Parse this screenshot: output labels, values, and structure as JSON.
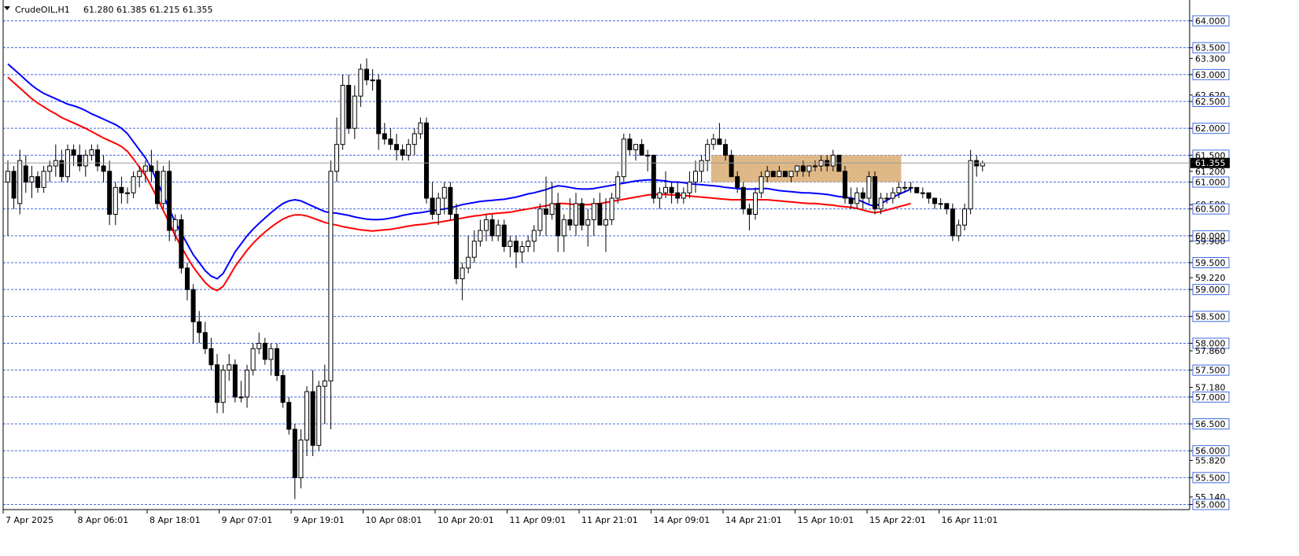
{
  "header": {
    "symbol": "CrudeOIL,H1",
    "ohlc": "61.280 61.385 61.215 61.355"
  },
  "chart_data": {
    "type": "candlestick",
    "symbol": "CrudeOIL",
    "timeframe": "H1",
    "ylim": [
      55.0,
      64.4
    ],
    "grid": true,
    "grid_levels": [
      64.0,
      63.5,
      63.0,
      62.5,
      62.0,
      61.5,
      61.0,
      60.5,
      60.0,
      59.5,
      59.0,
      58.5,
      58.0,
      57.5,
      57.0,
      56.5,
      56.0,
      55.5,
      55.0
    ],
    "price_labels": [
      {
        "value": 64.0,
        "text": "64.000",
        "boxed": true
      },
      {
        "value": 63.5,
        "text": "63.500",
        "boxed": true
      },
      {
        "value": 63.3,
        "text": "63.300",
        "boxed": false
      },
      {
        "value": 63.0,
        "text": "63.000",
        "boxed": true
      },
      {
        "value": 62.62,
        "text": "62.620",
        "boxed": false
      },
      {
        "value": 62.5,
        "text": "62.500",
        "boxed": true
      },
      {
        "value": 62.0,
        "text": "62.000",
        "boxed": true
      },
      {
        "value": 61.5,
        "text": "61.500",
        "boxed": true
      },
      {
        "value": 61.2,
        "text": "61.200",
        "boxed": false
      },
      {
        "value": 61.0,
        "text": "61.000",
        "boxed": true
      },
      {
        "value": 60.58,
        "text": "60.580",
        "boxed": false
      },
      {
        "value": 60.5,
        "text": "60.500",
        "boxed": true
      },
      {
        "value": 60.0,
        "text": "60.000",
        "boxed": true
      },
      {
        "value": 59.9,
        "text": "59.900",
        "boxed": false
      },
      {
        "value": 59.5,
        "text": "59.500",
        "boxed": true
      },
      {
        "value": 59.22,
        "text": "59.220",
        "boxed": false
      },
      {
        "value": 59.0,
        "text": "59.000",
        "boxed": true
      },
      {
        "value": 58.5,
        "text": "58.500",
        "boxed": true
      },
      {
        "value": 58.0,
        "text": "58.000",
        "boxed": true
      },
      {
        "value": 57.86,
        "text": "57.860",
        "boxed": false
      },
      {
        "value": 57.5,
        "text": "57.500",
        "boxed": true
      },
      {
        "value": 57.18,
        "text": "57.180",
        "boxed": false
      },
      {
        "value": 57.0,
        "text": "57.000",
        "boxed": true
      },
      {
        "value": 56.5,
        "text": "56.500",
        "boxed": true
      },
      {
        "value": 56.0,
        "text": "56.000",
        "boxed": true
      },
      {
        "value": 55.82,
        "text": "55.820",
        "boxed": false
      },
      {
        "value": 55.5,
        "text": "55.500",
        "boxed": true
      },
      {
        "value": 55.14,
        "text": "55.140",
        "boxed": false
      },
      {
        "value": 55.0,
        "text": "55.000",
        "boxed": true
      }
    ],
    "current_price": {
      "value": 61.355,
      "text": "61.355"
    },
    "time_labels": [
      "7 Apr 2025",
      "8 Apr 06:01",
      "8 Apr 18:01",
      "9 Apr 07:01",
      "9 Apr 19:01",
      "10 Apr 08:01",
      "10 Apr 20:01",
      "11 Apr 09:01",
      "11 Apr 21:01",
      "14 Apr 09:01",
      "14 Apr 21:01",
      "15 Apr 10:01",
      "15 Apr 22:01",
      "16 Apr 11:01"
    ],
    "resistance_zone": {
      "from_bar": 118,
      "to_bar": 149,
      "low": 61.0,
      "high": 61.5,
      "color": "#deb887"
    },
    "colors": {
      "grid": "#4169e1",
      "bull_body": "#ffffff",
      "bear_body": "#000000",
      "candle_outline": "#000000",
      "ma_fast": "#0000ff",
      "ma_slow": "#ff0000",
      "current_price_bg": "#000000"
    },
    "ma_fast": [
      63.2,
      63.1,
      63.0,
      62.9,
      62.8,
      62.72,
      62.65,
      62.6,
      62.55,
      62.5,
      62.45,
      62.42,
      62.38,
      62.33,
      62.27,
      62.22,
      62.17,
      62.12,
      62.07,
      62.0,
      61.9,
      61.75,
      61.6,
      61.45,
      61.25,
      61.0,
      60.75,
      60.5,
      60.25,
      60.05,
      59.85,
      59.65,
      59.5,
      59.35,
      59.25,
      59.2,
      59.3,
      59.5,
      59.7,
      59.85,
      60.0,
      60.12,
      60.23,
      60.33,
      60.43,
      60.52,
      60.6,
      60.65,
      60.67,
      60.65,
      60.6,
      60.55,
      60.5,
      60.45,
      60.43,
      60.42,
      60.4,
      60.38,
      60.35,
      60.33,
      60.31,
      60.3,
      60.3,
      60.31,
      60.33,
      60.35,
      60.38,
      60.4,
      60.42,
      60.43,
      60.45,
      60.47,
      60.48,
      60.5,
      60.52,
      60.55,
      60.58,
      60.6,
      60.62,
      60.64,
      60.65,
      60.66,
      60.67,
      60.68,
      60.7,
      60.72,
      60.75,
      60.78,
      60.8,
      60.83,
      60.86,
      60.9,
      60.93,
      60.92,
      60.9,
      60.88,
      60.87,
      60.87,
      60.88,
      60.9,
      60.92,
      60.94,
      60.96,
      60.98,
      61.0,
      61.02,
      61.03,
      61.04,
      61.04,
      61.03,
      61.02,
      61.0,
      61.0,
      60.99,
      60.97,
      60.96,
      60.95,
      60.94,
      60.93,
      60.92,
      60.9,
      60.89,
      60.88,
      60.87,
      60.87,
      60.87,
      60.88,
      60.88,
      60.86,
      60.84,
      60.83,
      60.82,
      60.81,
      60.8,
      60.8,
      60.79,
      60.78,
      60.77,
      60.75,
      60.73,
      60.72,
      60.7,
      60.68,
      60.63,
      60.58,
      60.55,
      60.6,
      60.66,
      60.72,
      60.77,
      60.82,
      60.87
    ],
    "ma_slow": [
      62.95,
      62.85,
      62.75,
      62.65,
      62.55,
      62.47,
      62.4,
      62.33,
      62.27,
      62.2,
      62.15,
      62.1,
      62.05,
      62.0,
      61.94,
      61.88,
      61.82,
      61.77,
      61.72,
      61.66,
      61.57,
      61.43,
      61.28,
      61.12,
      60.92,
      60.7,
      60.47,
      60.24,
      60.0,
      59.8,
      59.6,
      59.42,
      59.27,
      59.13,
      59.03,
      58.98,
      59.06,
      59.24,
      59.43,
      59.58,
      59.73,
      59.86,
      59.97,
      60.07,
      60.16,
      60.24,
      60.31,
      60.36,
      60.39,
      60.39,
      60.37,
      60.33,
      60.29,
      60.25,
      60.22,
      60.2,
      60.17,
      60.15,
      60.13,
      60.11,
      60.1,
      60.09,
      60.1,
      60.11,
      60.12,
      60.14,
      60.16,
      60.18,
      60.2,
      60.21,
      60.22,
      60.24,
      60.25,
      60.27,
      60.29,
      60.31,
      60.33,
      60.35,
      60.37,
      60.38,
      60.4,
      60.41,
      60.42,
      60.43,
      60.44,
      60.46,
      60.48,
      60.5,
      60.52,
      60.54,
      60.56,
      60.58,
      60.6,
      60.6,
      60.59,
      60.58,
      60.58,
      60.58,
      60.59,
      60.6,
      60.62,
      60.64,
      60.66,
      60.68,
      60.7,
      60.72,
      60.74,
      60.76,
      60.77,
      60.77,
      60.77,
      60.76,
      60.76,
      60.75,
      60.74,
      60.73,
      60.72,
      60.71,
      60.7,
      60.69,
      60.68,
      60.67,
      60.67,
      60.67,
      60.67,
      60.67,
      60.67,
      60.67,
      60.66,
      60.65,
      60.64,
      60.63,
      60.62,
      60.61,
      60.6,
      60.6,
      60.59,
      60.58,
      60.57,
      60.55,
      60.54,
      60.53,
      60.51,
      60.48,
      60.45,
      60.43,
      60.45,
      60.48,
      60.51,
      60.54,
      60.57,
      60.6
    ],
    "candles": [
      [
        61.0,
        61.4,
        60.0,
        61.2
      ],
      [
        61.2,
        61.3,
        60.5,
        60.7
      ],
      [
        60.6,
        61.6,
        60.4,
        61.4
      ],
      [
        61.3,
        61.5,
        60.8,
        61.0
      ],
      [
        61.0,
        61.3,
        60.7,
        61.1
      ],
      [
        61.1,
        61.2,
        60.8,
        60.9
      ],
      [
        60.9,
        61.3,
        60.8,
        61.2
      ],
      [
        61.2,
        61.4,
        61.0,
        61.3
      ],
      [
        61.3,
        61.7,
        61.1,
        61.4
      ],
      [
        61.4,
        61.6,
        61.0,
        61.1
      ],
      [
        61.1,
        61.7,
        61.0,
        61.6
      ],
      [
        61.6,
        61.7,
        61.3,
        61.5
      ],
      [
        61.5,
        61.7,
        61.2,
        61.3
      ],
      [
        61.3,
        61.6,
        61.1,
        61.5
      ],
      [
        61.5,
        61.7,
        61.4,
        61.6
      ],
      [
        61.6,
        61.7,
        61.2,
        61.3
      ],
      [
        61.3,
        61.5,
        61.0,
        61.2
      ],
      [
        61.2,
        61.4,
        60.2,
        60.4
      ],
      [
        60.4,
        61.0,
        60.2,
        60.9
      ],
      [
        60.9,
        61.1,
        60.6,
        60.8
      ],
      [
        60.8,
        60.9,
        60.6,
        60.8
      ],
      [
        60.8,
        61.2,
        60.7,
        61.1
      ],
      [
        61.1,
        61.3,
        60.9,
        61.2
      ],
      [
        61.2,
        61.4,
        61.0,
        61.3
      ],
      [
        61.3,
        61.6,
        61.0,
        61.2
      ],
      [
        61.2,
        61.4,
        60.5,
        60.6
      ],
      [
        60.6,
        61.3,
        60.5,
        61.2
      ],
      [
        61.2,
        61.4,
        59.9,
        60.1
      ],
      [
        60.1,
        60.4,
        59.9,
        60.3
      ],
      [
        60.3,
        60.4,
        59.3,
        59.4
      ],
      [
        59.4,
        59.5,
        58.8,
        59.0
      ],
      [
        59.0,
        59.1,
        58.0,
        58.4
      ],
      [
        58.4,
        58.6,
        58.0,
        58.2
      ],
      [
        58.2,
        58.4,
        57.8,
        57.9
      ],
      [
        57.9,
        58.1,
        57.5,
        57.6
      ],
      [
        57.6,
        57.8,
        56.7,
        56.9
      ],
      [
        56.9,
        57.6,
        56.7,
        57.5
      ],
      [
        57.5,
        57.8,
        57.3,
        57.6
      ],
      [
        57.6,
        57.7,
        56.9,
        57.0
      ],
      [
        57.0,
        57.3,
        56.9,
        57.0
      ],
      [
        57.0,
        57.6,
        56.8,
        57.5
      ],
      [
        57.5,
        58.0,
        57.4,
        57.9
      ],
      [
        57.9,
        58.2,
        57.8,
        58.0
      ],
      [
        58.0,
        58.1,
        57.6,
        57.7
      ],
      [
        57.7,
        58.0,
        57.4,
        57.9
      ],
      [
        57.9,
        58.0,
        57.3,
        57.4
      ],
      [
        57.4,
        57.5,
        56.8,
        56.9
      ],
      [
        56.9,
        57.0,
        56.3,
        56.4
      ],
      [
        56.4,
        56.5,
        55.1,
        55.5
      ],
      [
        55.5,
        56.4,
        55.3,
        56.2
      ],
      [
        56.2,
        57.2,
        55.9,
        57.1
      ],
      [
        57.1,
        57.5,
        55.9,
        56.1
      ],
      [
        56.1,
        57.3,
        56.0,
        57.2
      ],
      [
        57.2,
        57.6,
        56.5,
        57.3
      ],
      [
        57.3,
        61.4,
        56.4,
        61.2
      ],
      [
        61.2,
        62.2,
        61.0,
        61.7
      ],
      [
        61.7,
        63.0,
        61.6,
        62.8
      ],
      [
        62.8,
        63.0,
        61.9,
        62.0
      ],
      [
        62.0,
        62.8,
        61.8,
        62.6
      ],
      [
        62.6,
        63.2,
        62.4,
        63.1
      ],
      [
        63.1,
        63.3,
        62.8,
        62.9
      ],
      [
        62.9,
        63.1,
        62.7,
        62.9
      ],
      [
        62.9,
        63.0,
        61.6,
        61.9
      ],
      [
        61.9,
        62.1,
        61.7,
        61.8
      ],
      [
        61.8,
        62.0,
        61.6,
        61.7
      ],
      [
        61.7,
        61.9,
        61.4,
        61.6
      ],
      [
        61.6,
        61.7,
        61.4,
        61.5
      ],
      [
        61.5,
        61.8,
        61.4,
        61.7
      ],
      [
        61.7,
        62.0,
        61.5,
        61.9
      ],
      [
        61.9,
        62.2,
        61.8,
        62.1
      ],
      [
        62.1,
        62.2,
        60.6,
        60.7
      ],
      [
        60.7,
        61.0,
        60.3,
        60.4
      ],
      [
        60.4,
        60.8,
        60.2,
        60.7
      ],
      [
        60.7,
        61.0,
        60.4,
        60.9
      ],
      [
        60.9,
        61.0,
        60.3,
        60.4
      ],
      [
        60.4,
        60.6,
        59.1,
        59.2
      ],
      [
        59.2,
        59.5,
        58.8,
        59.4
      ],
      [
        59.4,
        60.0,
        59.3,
        59.6
      ],
      [
        59.6,
        60.1,
        59.5,
        59.9
      ],
      [
        59.9,
        60.3,
        59.8,
        60.1
      ],
      [
        60.1,
        60.4,
        59.9,
        60.3
      ],
      [
        60.3,
        60.4,
        59.9,
        60.0
      ],
      [
        60.0,
        60.3,
        59.9,
        60.2
      ],
      [
        60.2,
        60.3,
        59.7,
        59.8
      ],
      [
        59.8,
        60.0,
        59.6,
        59.9
      ],
      [
        59.9,
        60.0,
        59.4,
        59.7
      ],
      [
        59.7,
        59.9,
        59.5,
        59.8
      ],
      [
        59.8,
        60.0,
        59.7,
        59.9
      ],
      [
        59.9,
        60.2,
        59.7,
        60.1
      ],
      [
        60.1,
        60.6,
        60.0,
        60.5
      ],
      [
        60.5,
        61.1,
        60.0,
        60.4
      ],
      [
        60.4,
        61.0,
        60.3,
        60.6
      ],
      [
        60.6,
        60.8,
        59.7,
        60.0
      ],
      [
        60.0,
        60.4,
        59.7,
        60.3
      ],
      [
        60.3,
        60.7,
        60.1,
        60.2
      ],
      [
        60.2,
        60.8,
        60.0,
        60.6
      ],
      [
        60.6,
        60.7,
        60.1,
        60.2
      ],
      [
        60.2,
        60.5,
        59.8,
        60.3
      ],
      [
        60.3,
        60.7,
        60.0,
        60.6
      ],
      [
        60.6,
        60.8,
        60.2,
        60.2
      ],
      [
        60.2,
        60.7,
        59.7,
        60.3
      ],
      [
        60.3,
        60.8,
        60.2,
        60.7
      ],
      [
        60.7,
        61.2,
        60.6,
        61.1
      ],
      [
        61.1,
        61.9,
        61.0,
        61.8
      ],
      [
        61.8,
        61.9,
        61.5,
        61.6
      ],
      [
        61.6,
        61.7,
        61.4,
        61.7
      ],
      [
        61.7,
        61.8,
        61.5,
        61.5
      ],
      [
        61.5,
        61.6,
        61.2,
        61.5
      ],
      [
        61.5,
        61.5,
        60.6,
        60.7
      ],
      [
        60.7,
        60.9,
        60.5,
        60.8
      ],
      [
        60.8,
        61.2,
        60.7,
        60.9
      ],
      [
        60.9,
        61.0,
        60.6,
        60.8
      ],
      [
        60.8,
        61.0,
        60.6,
        60.7
      ],
      [
        60.7,
        60.9,
        60.6,
        60.8
      ],
      [
        60.8,
        61.2,
        60.7,
        61.0
      ],
      [
        61.0,
        61.4,
        60.8,
        61.2
      ],
      [
        61.2,
        61.5,
        61.0,
        61.4
      ],
      [
        61.4,
        61.8,
        61.2,
        61.7
      ],
      [
        61.7,
        61.9,
        61.6,
        61.8
      ],
      [
        61.8,
        62.1,
        61.7,
        61.7
      ],
      [
        61.7,
        61.8,
        61.4,
        61.5
      ],
      [
        61.5,
        61.6,
        61.1,
        61.1
      ],
      [
        61.1,
        61.2,
        60.8,
        60.9
      ],
      [
        60.9,
        61.0,
        60.4,
        60.5
      ],
      [
        60.5,
        60.6,
        60.1,
        60.4
      ],
      [
        60.4,
        60.9,
        60.3,
        60.8
      ],
      [
        60.8,
        61.2,
        60.7,
        61.1
      ],
      [
        61.1,
        61.3,
        61.0,
        61.2
      ],
      [
        61.2,
        61.2,
        61.1,
        61.1
      ],
      [
        61.1,
        61.3,
        61.1,
        61.2
      ],
      [
        61.2,
        61.2,
        61.1,
        61.1
      ],
      [
        61.1,
        61.2,
        61.0,
        61.2
      ],
      [
        61.2,
        61.3,
        61.1,
        61.3
      ],
      [
        61.3,
        61.4,
        61.1,
        61.2
      ],
      [
        61.2,
        61.3,
        61.1,
        61.3
      ],
      [
        61.3,
        61.4,
        61.2,
        61.3
      ],
      [
        61.3,
        61.5,
        61.2,
        61.4
      ],
      [
        61.4,
        61.5,
        61.2,
        61.3
      ],
      [
        61.3,
        61.6,
        61.2,
        61.5
      ],
      [
        61.5,
        61.5,
        61.2,
        61.2
      ],
      [
        61.2,
        61.3,
        60.6,
        60.7
      ],
      [
        60.7,
        60.9,
        60.5,
        60.6
      ],
      [
        60.6,
        60.9,
        60.5,
        60.8
      ],
      [
        60.8,
        60.9,
        60.5,
        60.7
      ],
      [
        60.7,
        61.2,
        60.6,
        61.1
      ],
      [
        61.1,
        61.2,
        60.4,
        60.5
      ],
      [
        60.5,
        60.8,
        60.4,
        60.7
      ],
      [
        60.7,
        60.8,
        60.6,
        60.7
      ],
      [
        60.7,
        60.9,
        60.6,
        60.8
      ],
      [
        60.8,
        61.0,
        60.7,
        60.9
      ],
      [
        60.9,
        61.0,
        60.8,
        60.9
      ],
      [
        60.9,
        61.0,
        60.8,
        60.9
      ],
      [
        60.9,
        60.9,
        60.8,
        60.8
      ],
      [
        60.8,
        60.9,
        60.7,
        60.8
      ],
      [
        60.8,
        60.8,
        60.6,
        60.7
      ],
      [
        60.7,
        60.7,
        60.5,
        60.6
      ],
      [
        60.6,
        60.7,
        60.5,
        60.6
      ],
      [
        60.6,
        60.6,
        60.4,
        60.5
      ],
      [
        60.5,
        60.6,
        59.9,
        60.0
      ],
      [
        60.0,
        60.3,
        59.9,
        60.2
      ],
      [
        60.2,
        60.6,
        60.1,
        60.5
      ],
      [
        60.5,
        61.6,
        60.4,
        61.4
      ],
      [
        61.4,
        61.5,
        61.1,
        61.3
      ],
      [
        61.3,
        61.4,
        61.2,
        61.355
      ]
    ]
  }
}
